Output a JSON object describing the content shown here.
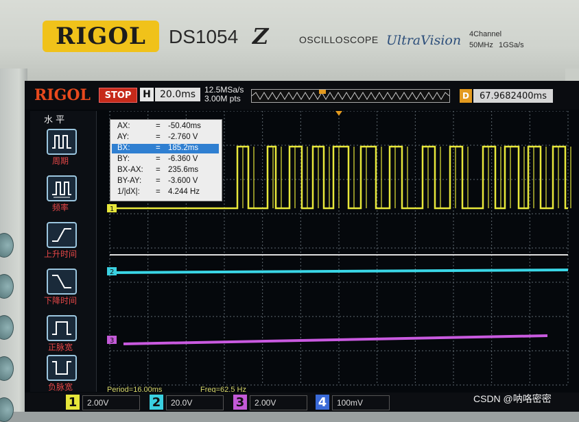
{
  "device": {
    "brand": "RIGOL",
    "model": "DS1054",
    "model_suffix": "Z",
    "type_label": "OSCILLOSCOPE",
    "tech_label": "UltraVision",
    "spec_channels": "4Channel",
    "spec_bandwidth": "50MHz",
    "spec_samplerate": "1GSa/s"
  },
  "topbar": {
    "logo": "RIGOL",
    "run_state": "STOP",
    "timebase_key": "H",
    "timebase_value": "20.0ms",
    "sample_rate": "12.5MSa/s",
    "memory_depth": "3.00M pts",
    "trigger_key": "D",
    "trigger_value": "67.9682400ms"
  },
  "side_menu": {
    "title": "水 平",
    "items": [
      {
        "label": "周期",
        "icon": "period-icon"
      },
      {
        "label": "频率",
        "icon": "frequency-icon"
      },
      {
        "label": "上升时间",
        "icon": "rise-time-icon"
      },
      {
        "label": "下降时间",
        "icon": "fall-time-icon"
      },
      {
        "label": "正脉宽",
        "icon": "positive-pulse-width-icon"
      },
      {
        "label": "负脉宽",
        "icon": "negative-pulse-width-icon"
      }
    ]
  },
  "cursor_readout": {
    "rows": [
      {
        "key": "AX:",
        "value": "-50.40ms"
      },
      {
        "key": "AY:",
        "value": "-2.760 V"
      },
      {
        "key": "BX:",
        "value": "185.2ms"
      },
      {
        "key": "BY:",
        "value": "-6.360 V"
      },
      {
        "key": "BX-AX:",
        "value": "235.6ms"
      },
      {
        "key": "BY-AY:",
        "value": "-3.600 V"
      },
      {
        "key": "1/|dX|:",
        "value": "4.244 Hz"
      }
    ],
    "selected_row": "BX:"
  },
  "measurements": {
    "period": "Period=16.00ms",
    "freq": "Freq=62.5 Hz"
  },
  "channels": [
    {
      "num": "1",
      "scale": "2.00V",
      "color": "#e6e63a"
    },
    {
      "num": "2",
      "scale": "20.0V",
      "color": "#3ad0e0"
    },
    {
      "num": "3",
      "scale": "2.00V",
      "color": "#c45ad8"
    },
    {
      "num": "4",
      "scale": "100mV",
      "color": "#3a6ad8"
    }
  ],
  "waveforms": {
    "ch1": {
      "type": "square",
      "color": "#e8e83a",
      "frequency_hz": 62.5
    },
    "ch2": {
      "type": "flat",
      "color": "#3ad6e6"
    },
    "ch3": {
      "type": "flat",
      "color": "#c95ae0"
    },
    "ch4": {
      "type": "flat",
      "color": "#e0e0e0"
    }
  },
  "channel_markers": [
    "1",
    "2",
    "3"
  ],
  "watermark": "CSDN @呐咯密密"
}
